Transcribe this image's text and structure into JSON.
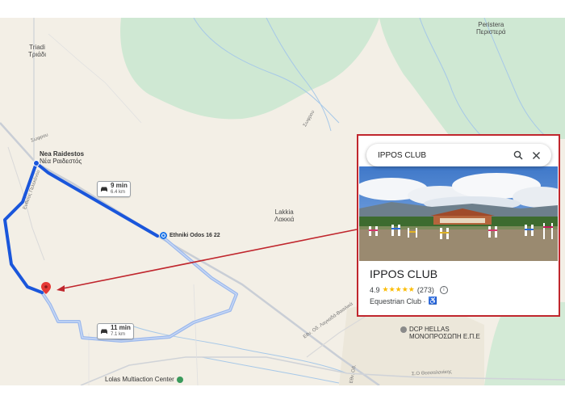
{
  "map": {
    "places": [
      {
        "name": "Peristera",
        "local": "Περιστερά"
      },
      {
        "name": "Triadi",
        "local": "Τριάδι"
      },
      {
        "name": "Nea Raidestos",
        "local": "Νέα Ραιδεστός"
      },
      {
        "name": "Lakkia",
        "local": "Λακκιά"
      }
    ],
    "roads": {
      "r1": "Σωφρου",
      "r2": "Ευθείας Πελεκάνου",
      "r3": "Εθν. Οδ. Λαγκαδά-Βασιλικά",
      "r4": "Σωφρου",
      "r5": "Εθν. Οδ.",
      "r6": "Σ.Ο Θεσσαλονίκης"
    },
    "waypoint": {
      "label": "Ethniki Odos 16 22"
    },
    "routes": [
      {
        "time": "9 min",
        "distance": "6.4 km",
        "selected": true
      },
      {
        "time": "11 min",
        "distance": "7.1 km",
        "selected": false
      }
    ],
    "pois": [
      {
        "name": "DCP HELLAS",
        "sub": "ΜΟΝΟΠΡΟΣΩΠΗ Ε.Π.Ε"
      },
      {
        "name": "Lolas Multiaction Center"
      }
    ],
    "colors": {
      "land": "#f3efe6",
      "forest": "#cfe8d3",
      "route_selected": "#1a56db",
      "route_alt": "#9bb8ec",
      "highlight": "#c0262d"
    }
  },
  "card": {
    "search_text": "IPPOS CLUB",
    "search_icon": "search-icon",
    "close_icon": "close-icon",
    "name": "IPPOS CLUB",
    "rating": "4.9",
    "stars": "★★★★★",
    "reviews": "(273)",
    "category": "Equestrian Club ·",
    "accessibility_icon": "wheelchair-icon"
  }
}
